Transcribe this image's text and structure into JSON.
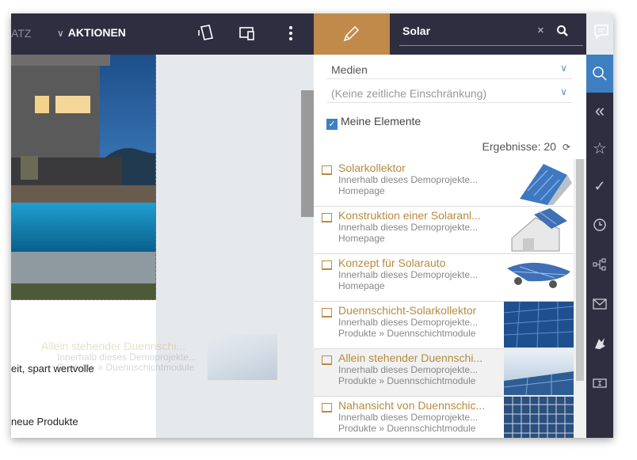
{
  "toolbar": {
    "cut_tab": "ATZ",
    "aktionen_label": "AKTIONEN"
  },
  "search": {
    "value": "Solar"
  },
  "filters": {
    "media_select": "Medien",
    "time_select": "(Keine zeitliche Einschränkung)",
    "my_elements_label": "Meine Elemente",
    "my_elements_checked": true,
    "results_label": "Ergebnisse: 20"
  },
  "results": [
    {
      "title": "Solarkollektor",
      "subtitle": "Innerhalb dieses Demoprojekte...",
      "path": "Homepage",
      "thumb": "solar-panel-3d"
    },
    {
      "title": "Konstruktion einer Solaranl...",
      "subtitle": "Innerhalb dieses Demoprojekte...",
      "path": "Homepage",
      "thumb": "house-roof-panel"
    },
    {
      "title": "Konzept für Solarauto",
      "subtitle": "Innerhalb dieses Demoprojekte...",
      "path": "Homepage",
      "thumb": "solar-car"
    },
    {
      "title": "Duennschicht-Solarkollektor",
      "subtitle": "Innerhalb dieses Demoprojekte...",
      "path": "Produkte » Duennschichtmodule",
      "thumb": "thin-film-panel"
    },
    {
      "title": "Allein stehender Duennschi...",
      "subtitle": "Innerhalb dieses Demoprojekte...",
      "path": "Produkte » Duennschichtmodule",
      "thumb": "panel-sky"
    },
    {
      "title": "Nahansicht von Duennschic...",
      "subtitle": "Innerhalb dieses Demoprojekte...",
      "path": "Produkte » Duennschichtmodule",
      "thumb": "panel-closeup"
    }
  ],
  "drag_ghost": {
    "title": "Allein stehender Duennschi...",
    "subtitle": "Innerhalb dieses Demoprojekte...",
    "path": "Produkte » Duennschichtmodule"
  },
  "canvas": {
    "text_line_1": "eit, spart wertvolle",
    "text_line_2": "neue Produkte"
  },
  "rail_icons": [
    "search-icon",
    "double-chevron-left-icon",
    "star-icon",
    "check-icon",
    "clock-icon",
    "sitemap-icon",
    "mail-icon",
    "brand-icon",
    "text-field-icon"
  ],
  "colors": {
    "dark": "#2f2e41",
    "accent": "#c08a4a",
    "link": "#b78a3f",
    "blue": "#3d7fc1"
  }
}
